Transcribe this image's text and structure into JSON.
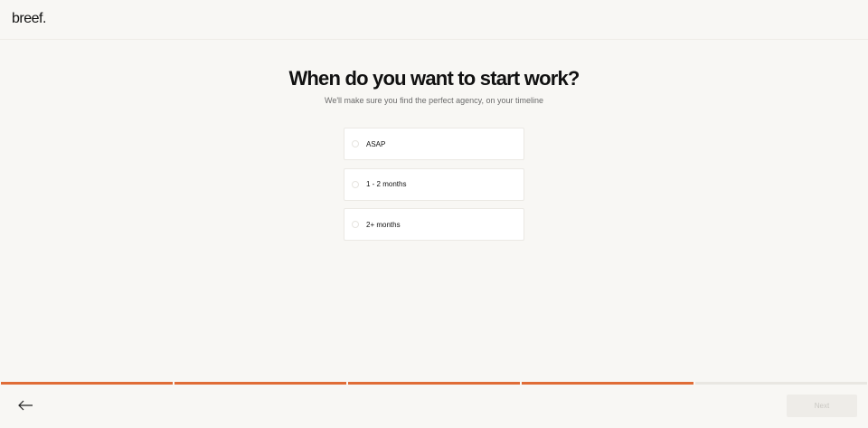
{
  "header": {
    "logo": "breef."
  },
  "question": {
    "title": "When do you want to start work?",
    "subtitle": "We'll make sure you find the perfect agency, on your timeline"
  },
  "options": [
    {
      "label": "ASAP",
      "selected": false
    },
    {
      "label": "1 - 2 months",
      "selected": false
    },
    {
      "label": "2+ months",
      "selected": false
    }
  ],
  "progress": {
    "total_steps": 5,
    "completed_steps": 4,
    "accent": "#e06c36"
  },
  "footer": {
    "back_icon": "arrow-left-icon",
    "next_label": "Next",
    "next_enabled": false
  }
}
